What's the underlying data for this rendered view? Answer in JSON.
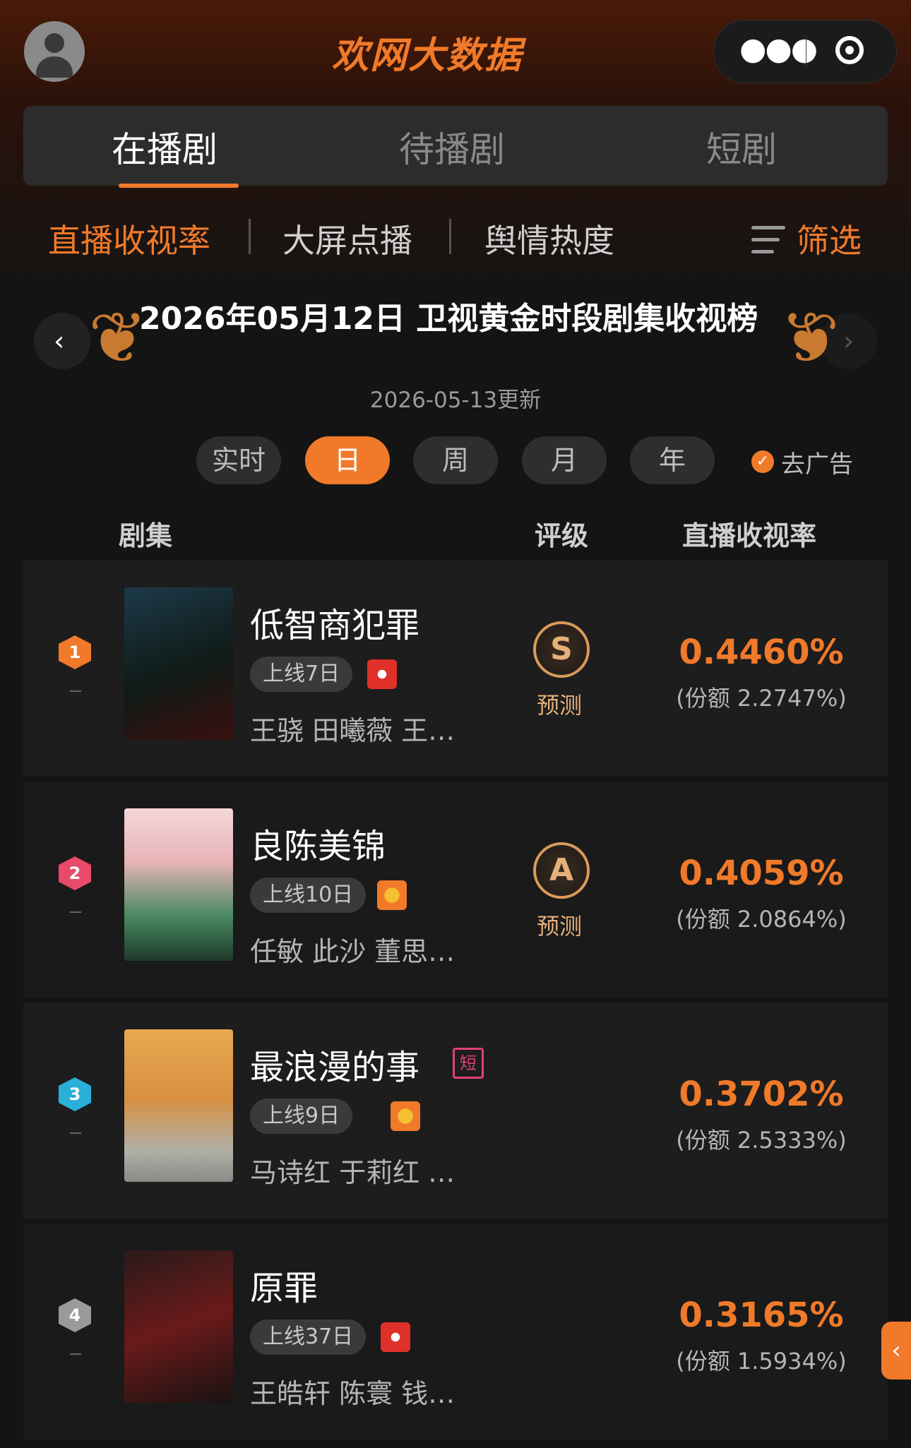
{
  "header": {
    "logo": "欢网大数据",
    "more_icon": "more-dots-icon",
    "scan_icon": "target-icon"
  },
  "tabs": [
    {
      "label": "在播剧",
      "active": true
    },
    {
      "label": "待播剧",
      "active": false
    },
    {
      "label": "短剧",
      "active": false
    }
  ],
  "subnav": {
    "items": [
      "直播收视率",
      "大屏点播",
      "舆情热度"
    ],
    "active": "直播收视率",
    "filter_label": "筛选"
  },
  "title": {
    "main": "2026年05月12日 卫视黄金时段剧集收视榜",
    "updated": "2026-05-13更新"
  },
  "periods": {
    "items": [
      "实时",
      "日",
      "周",
      "月",
      "年"
    ],
    "active": "日",
    "no_ad_label": "去广告"
  },
  "columns": {
    "series": "剧集",
    "grade": "评级",
    "rating": "直播收视率"
  },
  "colors": {
    "accent": "#f07a2a"
  },
  "rows": [
    {
      "rank": "1",
      "title": "低智商犯罪",
      "online": "上线7日",
      "channel": "dragon-tv-icon",
      "cast": "王骁 田曦薇 王…",
      "grade": "S",
      "grade_label": "预测",
      "rating": "0.4460%",
      "share": "(份额 2.2747%)"
    },
    {
      "rank": "2",
      "title": "良陈美锦",
      "online": "上线10日",
      "channel": "hunan-tv-icon",
      "cast": "任敏 此沙 董思…",
      "grade": "A",
      "grade_label": "预测",
      "rating": "0.4059%",
      "share": "(份额 2.0864%)"
    },
    {
      "rank": "3",
      "title": "最浪漫的事",
      "short_badge": "短",
      "online": "上线9日",
      "channel": "hunan-tv-icon",
      "cast": "马诗红 于莉红 …",
      "rating": "0.3702%",
      "share": "(份额 2.5333%)"
    },
    {
      "rank": "4",
      "title": "原罪",
      "online": "上线37日",
      "channel": "dragon-tv-icon",
      "cast": "王皓轩 陈寰 钱…",
      "rating": "0.3165%",
      "share": "(份额 1.5934%)"
    }
  ]
}
